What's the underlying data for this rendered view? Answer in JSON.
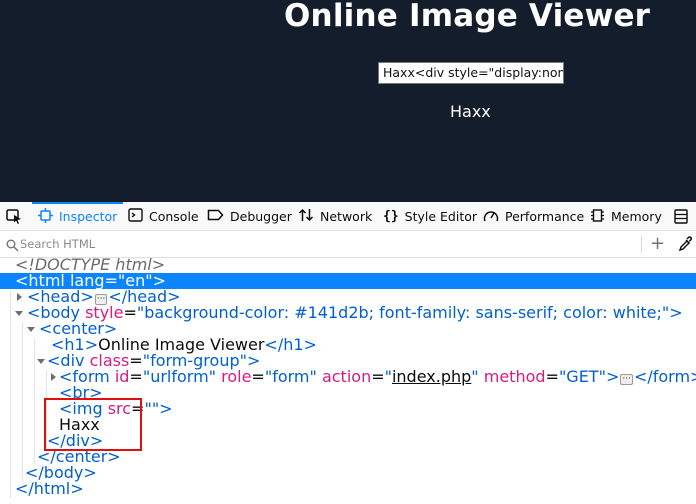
{
  "page": {
    "title": "Online Image Viewer",
    "url_input_value": "Haxx<div style=\"display:none'",
    "haxx_text": "Haxx"
  },
  "devtools": {
    "tabs": [
      {
        "label": "Inspector",
        "icon": "inspector-icon",
        "active": true
      },
      {
        "label": "Console",
        "icon": "console-icon"
      },
      {
        "label": "Debugger",
        "icon": "debugger-icon"
      },
      {
        "label": "Network",
        "icon": "network-icon"
      },
      {
        "label": "Style Editor",
        "icon": "style-editor-icon"
      },
      {
        "label": "Performance",
        "icon": "performance-icon"
      },
      {
        "label": "Memory",
        "icon": "memory-icon"
      }
    ],
    "search_placeholder": "Search HTML",
    "add_node": "+",
    "tree": {
      "doctype": "<!DOCTYPE html>",
      "html_open_tag": "<html",
      "html_lang_attr": "lang",
      "html_lang_val": "\"en\"",
      "html_close_bracket": ">",
      "head_open": "<head>",
      "head_close": "</head>",
      "body_open": "<body",
      "body_style_attr": "style",
      "body_style_val": "\"background-color: #141d2b; font-family: sans-serif; color: white;\"",
      "center_open": "<center>",
      "h1_open": "<h1>",
      "h1_text": "Online Image Viewer",
      "h1_close": "</h1>",
      "div_open": "<div",
      "div_class_attr": "class",
      "div_class_val": "\"form-group\"",
      "form_open": "<form",
      "form_id_attr": "id",
      "form_id_val": "\"urlform\"",
      "form_role_attr": "role",
      "form_role_val": "\"form\"",
      "form_action_attr": "action",
      "form_action_val": "index.php",
      "form_method_attr": "method",
      "form_method_val": "\"GET\"",
      "form_close": "</form>",
      "br": "<br>",
      "img_open": "<img",
      "img_src_attr": "src",
      "img_src_val": "\"\"",
      "haxx_text": "Haxx",
      "div_close": "</div>",
      "center_close": "</center>",
      "body_close": "</body>",
      "html_close": "</html>"
    }
  },
  "colors": {
    "page_bg": "#141d2b",
    "selected_row": "#0a84ff",
    "tag": "#0060cc",
    "attr_name": "#d41c81",
    "highlight_box": "#e01010"
  }
}
